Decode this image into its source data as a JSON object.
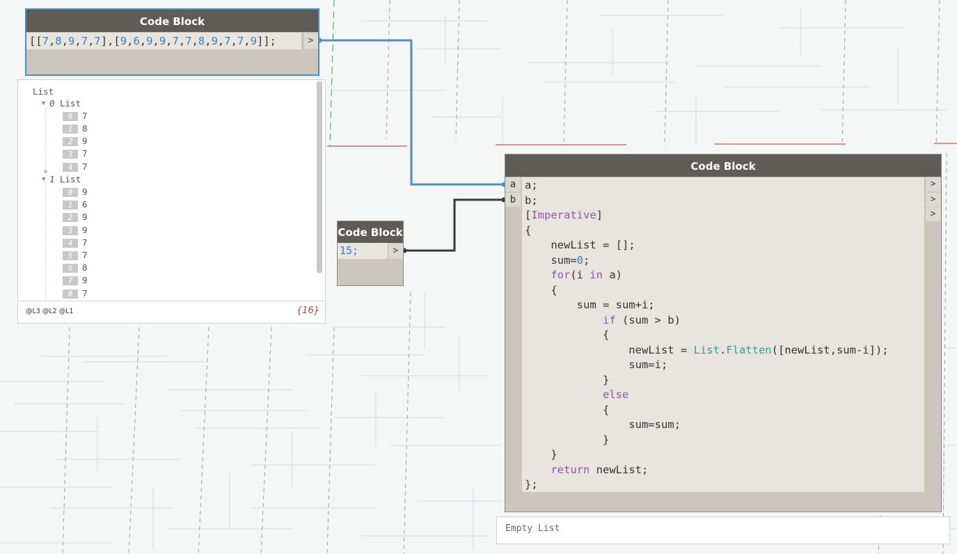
{
  "nodes": {
    "list_block": {
      "title": "Code Block",
      "code": "[[7,8,9,7,7],[9,6,9,9,7,7,8,9,7,7,9]];",
      "out_port": ">"
    },
    "number_block": {
      "title": "Code Block",
      "code": "15;",
      "out_port": ">"
    },
    "main_block": {
      "title": "Code Block",
      "inputs": [
        "a",
        "b"
      ],
      "outputs": [
        ">",
        ">",
        ">"
      ],
      "code_lines": [
        "a;",
        "b;",
        "[Imperative]",
        "{",
        "    newList = [];",
        "    sum=0;",
        "    for(i in a)",
        "    {",
        "        sum = sum+i;",
        "            if (sum > b)",
        "            {",
        "                newList = List.Flatten([newList,sum-i]);",
        "                sum=i;",
        "            }",
        "            else",
        "            {",
        "                sum=sum;",
        "            }",
        "    }",
        "    return newList;",
        "};"
      ],
      "preview": "Empty List"
    }
  },
  "watch": {
    "root_label": "List",
    "groups": [
      {
        "index": "0",
        "label": "List",
        "items": [
          "7",
          "8",
          "9",
          "7",
          "7"
        ]
      },
      {
        "index": "1",
        "label": "List",
        "items": [
          "9",
          "6",
          "9",
          "9",
          "7",
          "7",
          "8",
          "9",
          "7"
        ]
      }
    ],
    "levels": "@L3 @L2 @L1",
    "count": "{16}"
  },
  "colors": {
    "selected_wire": "#4a90c8",
    "wire": "#3a3a3a",
    "node_header": "#5f5c58",
    "node_body": "#cbc6be",
    "code_bg": "#e8e5e1"
  }
}
